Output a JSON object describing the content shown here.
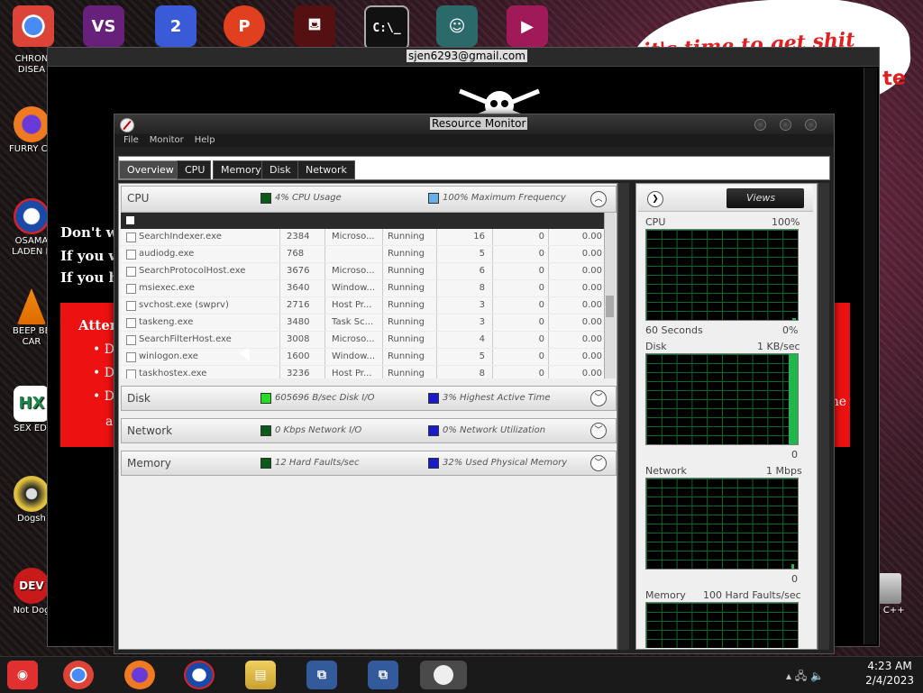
{
  "desktop": {
    "icons_left": [
      {
        "label": "CHRON\nDISEA",
        "icon": "chrome-icon"
      },
      {
        "label": "FURRY CU",
        "icon": "firefox-icon"
      },
      {
        "label": "OSAMA\nLADEN E",
        "icon": "obama-logo-icon"
      },
      {
        "label": "BEEP BE\nCAR",
        "icon": "vlc-cone-icon"
      },
      {
        "label": "SEX EDI",
        "icon": "hx-icon"
      },
      {
        "label": "Dogsh",
        "icon": "dogsh-icon"
      },
      {
        "label": "Not Dog",
        "icon": "dev-cpp-icon"
      }
    ],
    "icon_right_label": "n C++"
  },
  "background_window": {
    "email": "sjen6293@gmail.com",
    "lines": [
      "Don't wo",
      "If you w",
      "If you ha"
    ],
    "attention": "Atten",
    "bullets": [
      "D",
      "D",
      "D"
    ],
    "tail_right": "ne",
    "tail_left": "a",
    "speech_text": "it's time to get shit",
    "speech_tail": "te"
  },
  "resource_monitor": {
    "title": "Resource Monitor",
    "menu": [
      "File",
      "Monitor",
      "Help"
    ],
    "tabs": [
      "Overview",
      "CPU",
      "Memory",
      "Disk",
      "Network"
    ],
    "cpu": {
      "name": "CPU",
      "stat1": "4% CPU Usage",
      "stat2": "100% Maximum Frequency",
      "stat1_color": "#0a5a1a",
      "stat2_color": "#6aaee8",
      "rows": [
        {
          "image": "SearchIndexer.exe",
          "pid": "2384",
          "desc": "Microso...",
          "status": "Running",
          "threads": "16",
          "cpu": "0",
          "avg": "0.00"
        },
        {
          "image": "audiodg.exe",
          "pid": "768",
          "desc": "",
          "status": "Running",
          "threads": "5",
          "cpu": "0",
          "avg": "0.00"
        },
        {
          "image": "SearchProtocolHost.exe",
          "pid": "3676",
          "desc": "Microso...",
          "status": "Running",
          "threads": "6",
          "cpu": "0",
          "avg": "0.00"
        },
        {
          "image": "msiexec.exe",
          "pid": "3640",
          "desc": "Window...",
          "status": "Running",
          "threads": "8",
          "cpu": "0",
          "avg": "0.00"
        },
        {
          "image": "svchost.exe (swprv)",
          "pid": "2716",
          "desc": "Host Pr...",
          "status": "Running",
          "threads": "3",
          "cpu": "0",
          "avg": "0.00"
        },
        {
          "image": "taskeng.exe",
          "pid": "3480",
          "desc": "Task Sc...",
          "status": "Running",
          "threads": "3",
          "cpu": "0",
          "avg": "0.00"
        },
        {
          "image": "SearchFilterHost.exe",
          "pid": "3008",
          "desc": "Microso...",
          "status": "Running",
          "threads": "4",
          "cpu": "0",
          "avg": "0.00"
        },
        {
          "image": "winlogon.exe",
          "pid": "1600",
          "desc": "Window...",
          "status": "Running",
          "threads": "5",
          "cpu": "0",
          "avg": "0.00"
        },
        {
          "image": "taskhostex.exe",
          "pid": "3236",
          "desc": "Host Pr...",
          "status": "Running",
          "threads": "8",
          "cpu": "0",
          "avg": "0.00"
        }
      ]
    },
    "disk": {
      "name": "Disk",
      "stat1": "605696 B/sec Disk I/O",
      "stat2": "3% Highest Active Time",
      "stat1_color": "#22dd22",
      "stat2_color": "#1a1acc"
    },
    "network": {
      "name": "Network",
      "stat1": "0 Kbps Network I/O",
      "stat2": "0% Network Utilization",
      "stat1_color": "#0a5a1a",
      "stat2_color": "#1a1acc"
    },
    "memory": {
      "name": "Memory",
      "stat1": "12 Hard Faults/sec",
      "stat2": "32% Used Physical Memory",
      "stat1_color": "#0a5a1a",
      "stat2_color": "#1a1acc"
    },
    "views_label": "Views",
    "graphs": {
      "cpu": {
        "label": "CPU",
        "max": "100%",
        "footer_left": "60 Seconds",
        "footer_right": "0%",
        "level": 0.02
      },
      "disk": {
        "label": "Disk",
        "max": "1 KB/sec",
        "footer_right": "0",
        "level": 1.0
      },
      "network": {
        "label": "Network",
        "max": "1 Mbps",
        "footer_right": "0",
        "level": 0.05
      },
      "memory": {
        "label": "Memory",
        "max": "100 Hard Faults/sec"
      }
    }
  },
  "taskbar": {
    "time": "4:23 AM",
    "date": "2/4/2023"
  }
}
